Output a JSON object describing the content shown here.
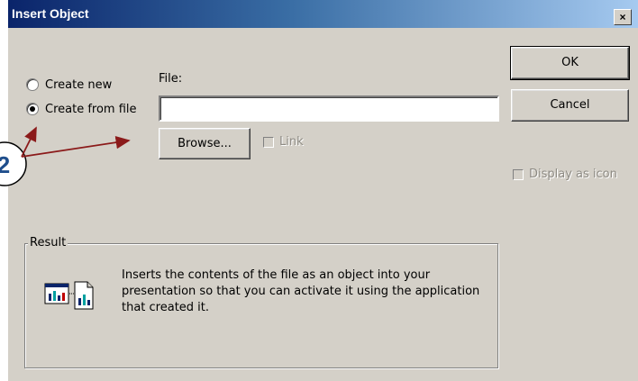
{
  "window": {
    "title": "Insert Object",
    "close_glyph": "×"
  },
  "options": {
    "create_new_label": "Create new",
    "create_from_file_label": "Create from file",
    "selected": "create_from_file"
  },
  "file": {
    "label": "File:",
    "value": ""
  },
  "buttons": {
    "ok": "OK",
    "cancel": "Cancel",
    "browse": "Browse..."
  },
  "checkboxes": {
    "link_label": "Link",
    "link_checked": false,
    "display_as_icon_label": "Display as icon",
    "display_as_icon_checked": false
  },
  "result": {
    "group_label": "Result",
    "description": "Inserts the contents of the file as an object into your presentation so that you can activate it using the application that created it.",
    "icon": "insert-object-document-icon"
  },
  "annotation": {
    "step_number": "2",
    "color": "#8b1a1a"
  },
  "colors": {
    "dialog_face": "#d4d0c8",
    "titlebar_start": "#0a246a",
    "titlebar_end": "#a6caf0"
  }
}
